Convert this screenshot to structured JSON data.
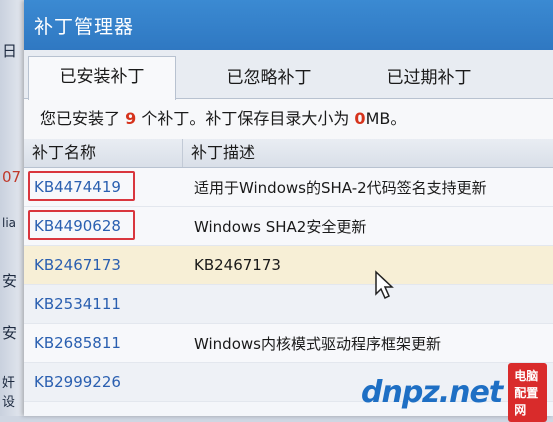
{
  "left_strip": [
    "日",
    "07",
    "lia",
    "安",
    "安",
    "奸设"
  ],
  "window": {
    "title": "补丁管理器"
  },
  "tabs": [
    {
      "label": "已安装补丁",
      "active": true
    },
    {
      "label": "已忽略补丁",
      "active": false
    },
    {
      "label": "已过期补丁",
      "active": false
    }
  ],
  "summary": {
    "prefix": "您已安装了 ",
    "count": "9",
    "middle": " 个补丁。补丁保存目录大小为 ",
    "size_num": "0",
    "size_unit": "MB。"
  },
  "table": {
    "headers": [
      "补丁名称",
      "补丁描述"
    ],
    "rows": [
      {
        "name": "KB4474419",
        "desc": "适用于Windows的SHA-2代码签名支持更新",
        "highlighted": true
      },
      {
        "name": "KB4490628",
        "desc": "Windows SHA2安全更新",
        "highlighted": true
      },
      {
        "name": "KB2467173",
        "desc": "KB2467173",
        "selected": true
      },
      {
        "name": "KB2534111",
        "desc": ""
      },
      {
        "name": "KB2685811",
        "desc": "Windows内核模式驱动程序框架更新"
      },
      {
        "name": "KB2999226",
        "desc": ""
      }
    ]
  },
  "watermark": {
    "logo": "dnpz.net",
    "badge": "电脑配置网"
  },
  "colors": {
    "accent": "#2f78c2",
    "count_red": "#d6331c",
    "highlight_box": "#d9363e",
    "link_blue": "#2a5fb0"
  }
}
